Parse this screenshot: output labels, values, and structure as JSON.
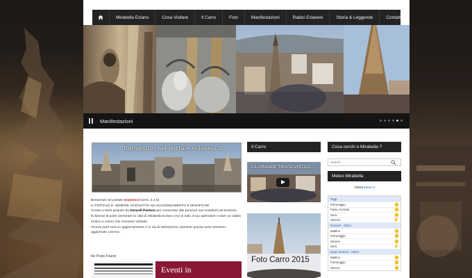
{
  "nav": {
    "items": [
      "Mirabella Eclano",
      "Cosa Visitare",
      "Il Carro",
      "Foto",
      "Manifestazioni",
      "Radici Eclanesi",
      "Storia & Leggende",
      "Contatti"
    ]
  },
  "slider": {
    "caption": "Manifestazioni",
    "dot_count": 6,
    "active_dot": 5
  },
  "welcome": {
    "banner_text": "Benvenuto nel portale eclanesi.it",
    "intro_prefix": "Benvenuti nel portale",
    "site_name": "eclanesi.it",
    "version": "[vers. 2.2.0]",
    "notice": "IL PORTALE E' SEMPRE SOGGETTO AD AGGIORNAMENTO E MODIFICHE",
    "p1_a": "Creato a titolo gratuito da",
    "author": "Gerardi Pastore",
    "p1_b": "per consentire alle persone non residenti nel territorio Eclanese di poter ammirare la città di Mirabella Eclano (Av) in tutto il suo splendore e dare un valido motivo a coloro che vorranno visitarla",
    "p2": "Alcune parti sono in aggiornamento e in via di ottimazione, pertanto questa area verranno aggiornate a breve.",
    "no_posts": "No Posts Found",
    "ad_text": "Eventi in"
  },
  "middle": {
    "heading": "Il Carro",
    "video_title": "LA GRANDE TIRATA VISTA D...",
    "photo_caption": "Foto Carro 2015"
  },
  "sidebar": {
    "search_heading": "Cosa cerchi a Mirabella ?",
    "search_placeholder": "Search…",
    "meteo_heading": "Meteo Mirabella",
    "credit_prefix": "©2014",
    "credit_link": "Meteo.it",
    "days": [
      {
        "label": "Oggi",
        "rows": [
          {
            "name": "Pomeriggio",
            "icon": "sun"
          },
          {
            "name": "Pasto Accirato",
            "icon": "sun"
          },
          {
            "name": "Sera",
            "icon": "sun"
          },
          {
            "name": "Serena",
            "icon": "moon"
          }
        ]
      },
      {
        "label": "Domani - 28/04",
        "rows": [
          {
            "name": "Mattino",
            "icon": "sun"
          },
          {
            "name": "Pomeriggio",
            "icon": "sun"
          },
          {
            "name": "Sereno",
            "icon": "sun"
          },
          {
            "name": "Sera",
            "icon": "moon"
          }
        ]
      },
      {
        "label": "Dopo domani - 29/04",
        "rows": [
          {
            "name": "Mattino",
            "icon": "sun"
          },
          {
            "name": "Pomeriggio",
            "icon": "sun"
          },
          {
            "name": "Sereno",
            "icon": "sun"
          }
        ]
      }
    ]
  },
  "colors": {
    "nav_bg": "#232323",
    "caption_bg": "#141414",
    "accent_red": "#b31b1b",
    "link_blue": "#2a5db0"
  }
}
